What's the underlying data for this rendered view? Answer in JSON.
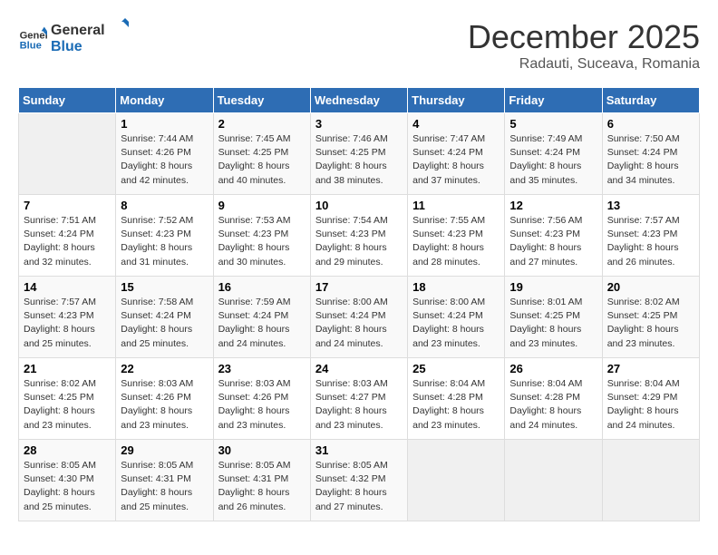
{
  "header": {
    "logo_line1": "General",
    "logo_line2": "Blue",
    "month": "December 2025",
    "location": "Radauti, Suceava, Romania"
  },
  "days_of_week": [
    "Sunday",
    "Monday",
    "Tuesday",
    "Wednesday",
    "Thursday",
    "Friday",
    "Saturday"
  ],
  "weeks": [
    [
      {
        "day": "",
        "info": ""
      },
      {
        "day": "1",
        "info": "Sunrise: 7:44 AM\nSunset: 4:26 PM\nDaylight: 8 hours\nand 42 minutes."
      },
      {
        "day": "2",
        "info": "Sunrise: 7:45 AM\nSunset: 4:25 PM\nDaylight: 8 hours\nand 40 minutes."
      },
      {
        "day": "3",
        "info": "Sunrise: 7:46 AM\nSunset: 4:25 PM\nDaylight: 8 hours\nand 38 minutes."
      },
      {
        "day": "4",
        "info": "Sunrise: 7:47 AM\nSunset: 4:24 PM\nDaylight: 8 hours\nand 37 minutes."
      },
      {
        "day": "5",
        "info": "Sunrise: 7:49 AM\nSunset: 4:24 PM\nDaylight: 8 hours\nand 35 minutes."
      },
      {
        "day": "6",
        "info": "Sunrise: 7:50 AM\nSunset: 4:24 PM\nDaylight: 8 hours\nand 34 minutes."
      }
    ],
    [
      {
        "day": "7",
        "info": "Sunrise: 7:51 AM\nSunset: 4:24 PM\nDaylight: 8 hours\nand 32 minutes."
      },
      {
        "day": "8",
        "info": "Sunrise: 7:52 AM\nSunset: 4:23 PM\nDaylight: 8 hours\nand 31 minutes."
      },
      {
        "day": "9",
        "info": "Sunrise: 7:53 AM\nSunset: 4:23 PM\nDaylight: 8 hours\nand 30 minutes."
      },
      {
        "day": "10",
        "info": "Sunrise: 7:54 AM\nSunset: 4:23 PM\nDaylight: 8 hours\nand 29 minutes."
      },
      {
        "day": "11",
        "info": "Sunrise: 7:55 AM\nSunset: 4:23 PM\nDaylight: 8 hours\nand 28 minutes."
      },
      {
        "day": "12",
        "info": "Sunrise: 7:56 AM\nSunset: 4:23 PM\nDaylight: 8 hours\nand 27 minutes."
      },
      {
        "day": "13",
        "info": "Sunrise: 7:57 AM\nSunset: 4:23 PM\nDaylight: 8 hours\nand 26 minutes."
      }
    ],
    [
      {
        "day": "14",
        "info": "Sunrise: 7:57 AM\nSunset: 4:23 PM\nDaylight: 8 hours\nand 25 minutes."
      },
      {
        "day": "15",
        "info": "Sunrise: 7:58 AM\nSunset: 4:24 PM\nDaylight: 8 hours\nand 25 minutes."
      },
      {
        "day": "16",
        "info": "Sunrise: 7:59 AM\nSunset: 4:24 PM\nDaylight: 8 hours\nand 24 minutes."
      },
      {
        "day": "17",
        "info": "Sunrise: 8:00 AM\nSunset: 4:24 PM\nDaylight: 8 hours\nand 24 minutes."
      },
      {
        "day": "18",
        "info": "Sunrise: 8:00 AM\nSunset: 4:24 PM\nDaylight: 8 hours\nand 23 minutes."
      },
      {
        "day": "19",
        "info": "Sunrise: 8:01 AM\nSunset: 4:25 PM\nDaylight: 8 hours\nand 23 minutes."
      },
      {
        "day": "20",
        "info": "Sunrise: 8:02 AM\nSunset: 4:25 PM\nDaylight: 8 hours\nand 23 minutes."
      }
    ],
    [
      {
        "day": "21",
        "info": "Sunrise: 8:02 AM\nSunset: 4:25 PM\nDaylight: 8 hours\nand 23 minutes."
      },
      {
        "day": "22",
        "info": "Sunrise: 8:03 AM\nSunset: 4:26 PM\nDaylight: 8 hours\nand 23 minutes."
      },
      {
        "day": "23",
        "info": "Sunrise: 8:03 AM\nSunset: 4:26 PM\nDaylight: 8 hours\nand 23 minutes."
      },
      {
        "day": "24",
        "info": "Sunrise: 8:03 AM\nSunset: 4:27 PM\nDaylight: 8 hours\nand 23 minutes."
      },
      {
        "day": "25",
        "info": "Sunrise: 8:04 AM\nSunset: 4:28 PM\nDaylight: 8 hours\nand 23 minutes."
      },
      {
        "day": "26",
        "info": "Sunrise: 8:04 AM\nSunset: 4:28 PM\nDaylight: 8 hours\nand 24 minutes."
      },
      {
        "day": "27",
        "info": "Sunrise: 8:04 AM\nSunset: 4:29 PM\nDaylight: 8 hours\nand 24 minutes."
      }
    ],
    [
      {
        "day": "28",
        "info": "Sunrise: 8:05 AM\nSunset: 4:30 PM\nDaylight: 8 hours\nand 25 minutes."
      },
      {
        "day": "29",
        "info": "Sunrise: 8:05 AM\nSunset: 4:31 PM\nDaylight: 8 hours\nand 25 minutes."
      },
      {
        "day": "30",
        "info": "Sunrise: 8:05 AM\nSunset: 4:31 PM\nDaylight: 8 hours\nand 26 minutes."
      },
      {
        "day": "31",
        "info": "Sunrise: 8:05 AM\nSunset: 4:32 PM\nDaylight: 8 hours\nand 27 minutes."
      },
      {
        "day": "",
        "info": ""
      },
      {
        "day": "",
        "info": ""
      },
      {
        "day": "",
        "info": ""
      }
    ]
  ]
}
